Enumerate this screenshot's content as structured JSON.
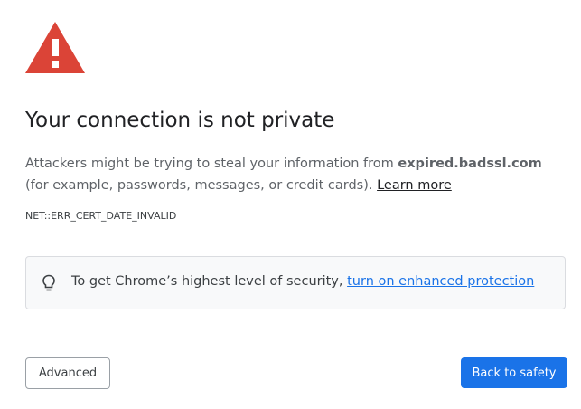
{
  "icons": {
    "warning": "warning-triangle-icon",
    "bulb": "lightbulb-icon"
  },
  "colors": {
    "warning_red": "#db4437",
    "link_blue": "#1a73e8",
    "primary_button": "#1a73e8"
  },
  "heading": "Your connection is not private",
  "description": {
    "prefix": "Attackers might be trying to steal your information from ",
    "host": "expired.badssl.com",
    "suffix": " (for example, passwords, messages, or credit cards). ",
    "learn_more": "Learn more"
  },
  "error_code": "NET::ERR_CERT_DATE_INVALID",
  "tip": {
    "text": "To get Chrome’s highest level of security, ",
    "link": "turn on enhanced protection"
  },
  "buttons": {
    "advanced": "Advanced",
    "back_to_safety": "Back to safety"
  }
}
